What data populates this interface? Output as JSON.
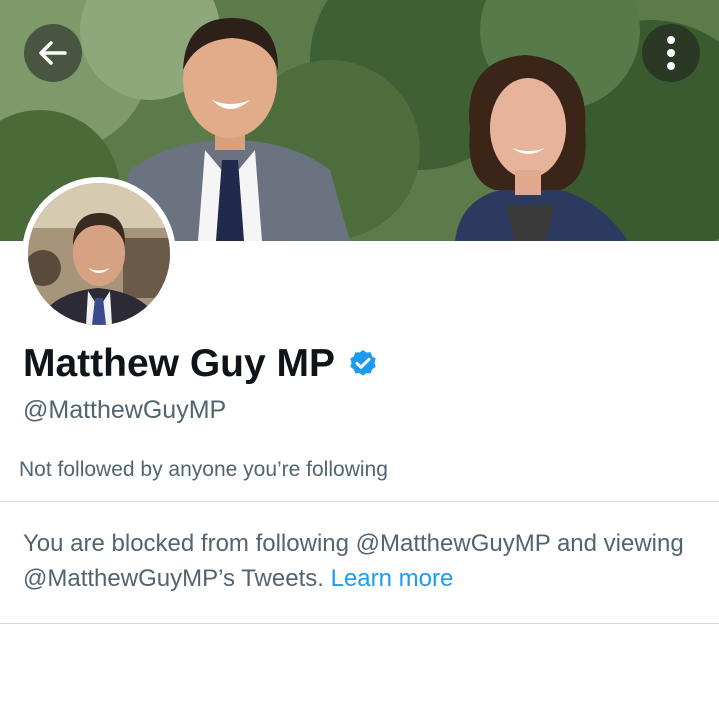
{
  "header": {
    "back_icon": "arrow-left-icon",
    "menu_icon": "more-vertical-icon"
  },
  "profile": {
    "display_name": "Matthew Guy MP",
    "verified_icon": "verified-badge-icon",
    "verified_color": "#1d9bf0",
    "handle": "@MatthewGuyMP",
    "followers_note": "Not followed by anyone you’re following"
  },
  "blocked_notice": {
    "text_line1": "You are blocked from following @MatthewGuyMP and viewing @MatthewGuyMP’s Tweets.",
    "link_label": "Learn more",
    "link_color": "#1d9bf0"
  }
}
